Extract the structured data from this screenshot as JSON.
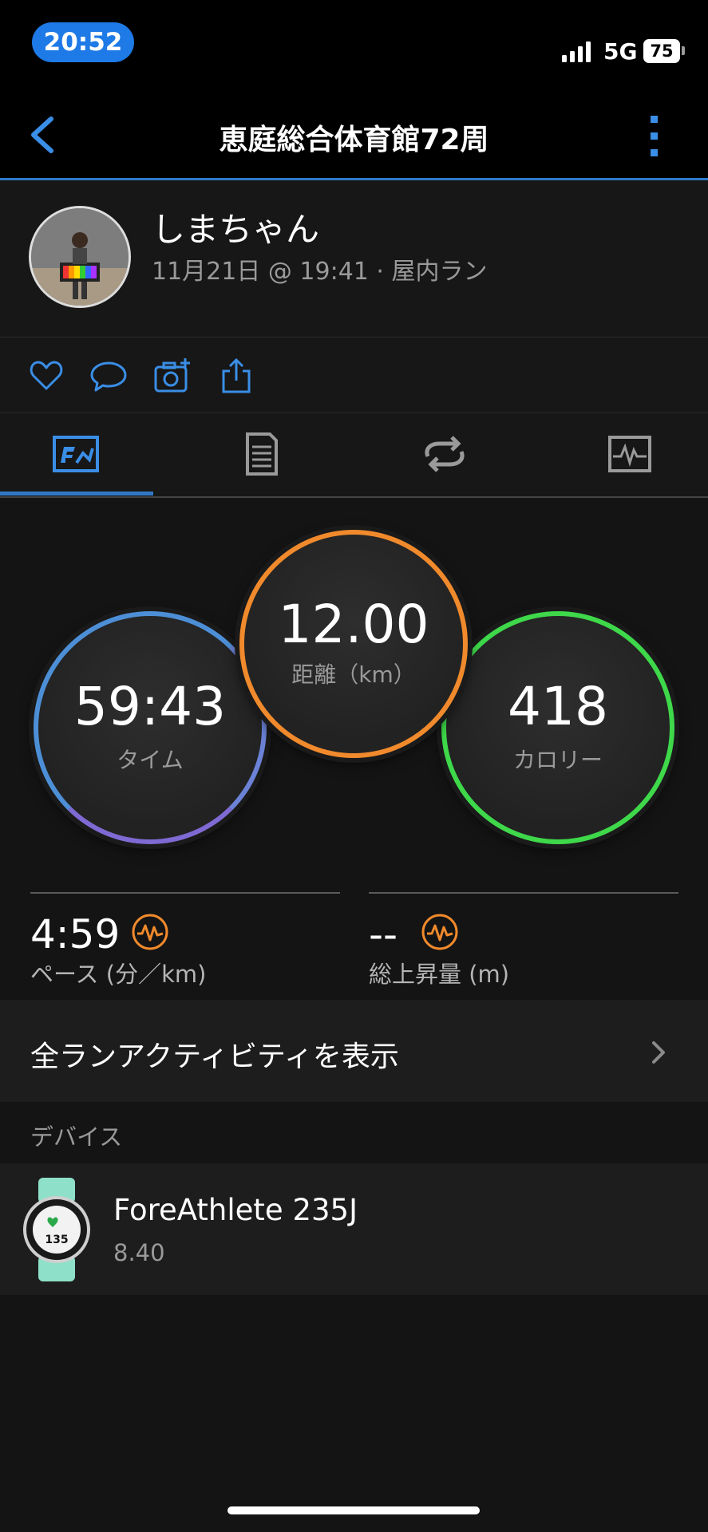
{
  "status_bar": {
    "time": "20:52",
    "network": "5G",
    "battery": "75"
  },
  "nav": {
    "title": "恵庭総合体育館72周"
  },
  "profile": {
    "name": "しまちゃん",
    "subtitle": "11月21日 @ 19:41 · 屋内ラン"
  },
  "actions": [
    "heart-icon",
    "comment-icon",
    "add-photo-icon",
    "share-icon"
  ],
  "tabs": [
    "overview-icon",
    "details-icon",
    "laps-icon",
    "chart-icon"
  ],
  "metrics": {
    "time": {
      "value": "59:43",
      "label": "タイム",
      "color": "#5b7fd8"
    },
    "distance": {
      "value": "12.00",
      "label": "距離（km）",
      "color": "#f08a2c"
    },
    "calories": {
      "value": "418",
      "label": "カロリー",
      "color": "#3ed84a"
    }
  },
  "stats": {
    "pace": {
      "value": "4:59",
      "label": "ペース (分／km)"
    },
    "ascent": {
      "value": "--",
      "label": "総上昇量 (m)"
    }
  },
  "view_all": {
    "label": "全ランアクティビティを表示"
  },
  "devices_section": {
    "label": "デバイス"
  },
  "device": {
    "name": "ForeAthlete 235J",
    "version": "8.40",
    "watch_face_value": "135"
  },
  "colors": {
    "accent": "#2f78c5",
    "orange": "#f08a2c"
  }
}
